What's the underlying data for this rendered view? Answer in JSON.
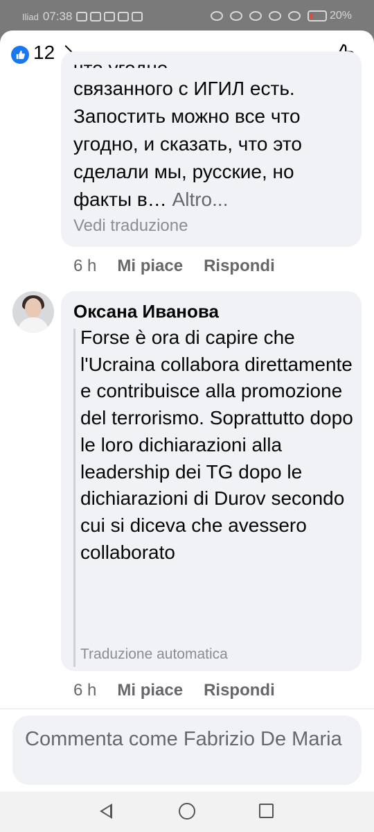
{
  "status_bar": {
    "carrier": "Iliad",
    "time": "07:38",
    "battery": "20%",
    "battery_level": 0.2,
    "battery_color": "#e04a3c"
  },
  "header": {
    "like_count": "12",
    "like_icon": "thumbs-up-icon",
    "accent": "#1877f2"
  },
  "comment1": {
    "truncated_line": "что угодно",
    "text": "связанного с ИГИЛ есть. Запостить можно все что угодно, и сказать, что это сделали мы, русские, но факты в…",
    "more": " Altro...",
    "translate": "Vedi traduzione",
    "time": "6 h",
    "like": "Mi piace",
    "reply": "Rispondi"
  },
  "comment2": {
    "author": "Оксана Иванова",
    "text": "Forse è ora di capire che l'Ucraina collabora direttamente e contribuisce alla promozione del terrorismo. Soprattutto dopo le loro dichiarazioni alla leadership dei TG dopo le dichiarazioni di Durov secondo cui si diceva che avessero collaborato",
    "auto_translation": "Traduzione automatica",
    "time": "6 h",
    "like": "Mi piace",
    "reply": "Rispondi"
  },
  "composer": {
    "placeholder": "Commenta come Fabrizio De Maria"
  }
}
